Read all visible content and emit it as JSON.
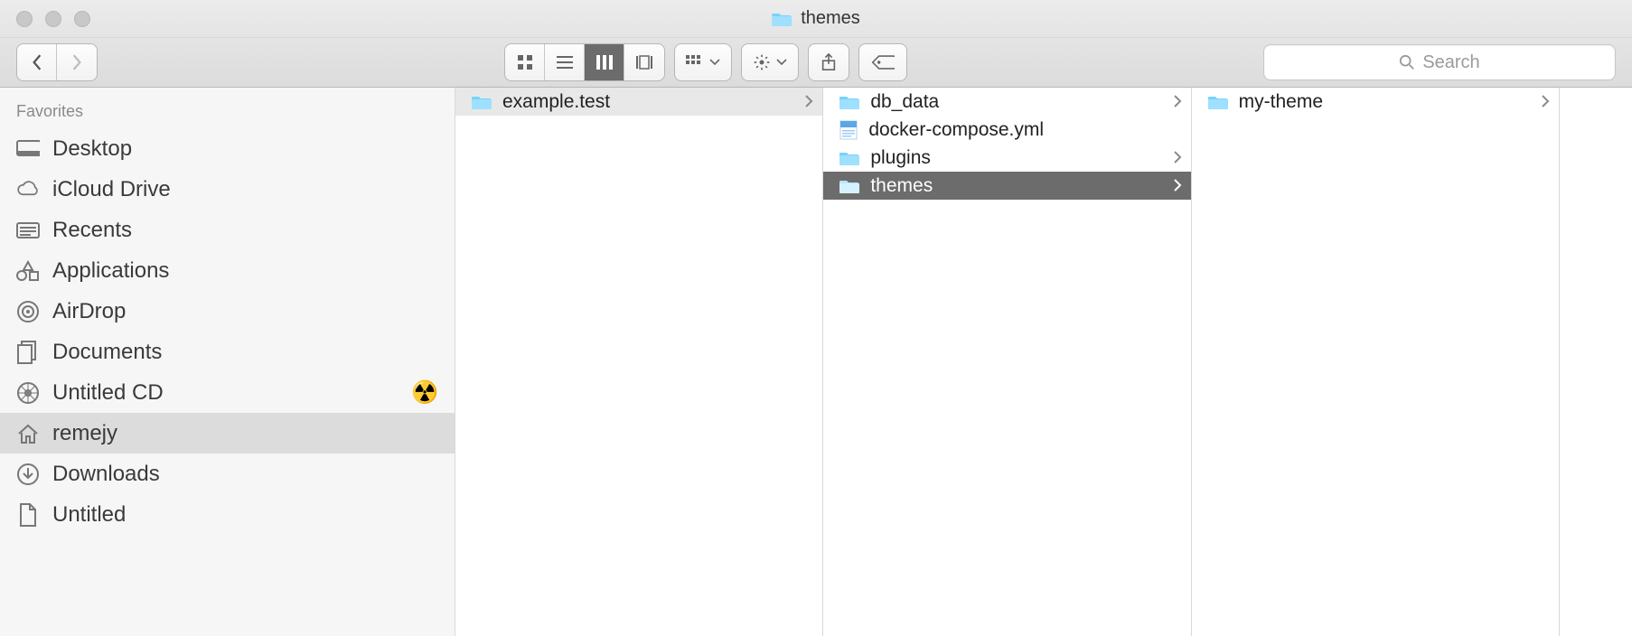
{
  "window": {
    "title": "themes"
  },
  "toolbar": {
    "search_placeholder": "Search"
  },
  "sidebar": {
    "header": "Favorites",
    "items": [
      {
        "icon": "desktop",
        "label": "Desktop",
        "selected": false
      },
      {
        "icon": "cloud",
        "label": "iCloud Drive",
        "selected": false
      },
      {
        "icon": "recents",
        "label": "Recents",
        "selected": false
      },
      {
        "icon": "apps",
        "label": "Applications",
        "selected": false
      },
      {
        "icon": "airdrop",
        "label": "AirDrop",
        "selected": false
      },
      {
        "icon": "documents",
        "label": "Documents",
        "selected": false
      },
      {
        "icon": "cd",
        "label": "Untitled CD",
        "selected": false,
        "trailing": "burn"
      },
      {
        "icon": "home",
        "label": "remejy",
        "selected": true
      },
      {
        "icon": "downloads",
        "label": "Downloads",
        "selected": false
      },
      {
        "icon": "file",
        "label": "Untitled",
        "selected": false
      }
    ]
  },
  "columns": [
    {
      "items": [
        {
          "type": "folder",
          "label": "example.test",
          "has_children": true,
          "sel": "path"
        }
      ]
    },
    {
      "items": [
        {
          "type": "folder",
          "label": "db_data",
          "has_children": true,
          "sel": ""
        },
        {
          "type": "yaml",
          "label": "docker-compose.yml",
          "has_children": false,
          "sel": ""
        },
        {
          "type": "folder",
          "label": "plugins",
          "has_children": true,
          "sel": ""
        },
        {
          "type": "folder",
          "label": "themes",
          "has_children": true,
          "sel": "active"
        }
      ]
    },
    {
      "items": [
        {
          "type": "folder",
          "label": "my-theme",
          "has_children": true,
          "sel": ""
        }
      ]
    }
  ]
}
